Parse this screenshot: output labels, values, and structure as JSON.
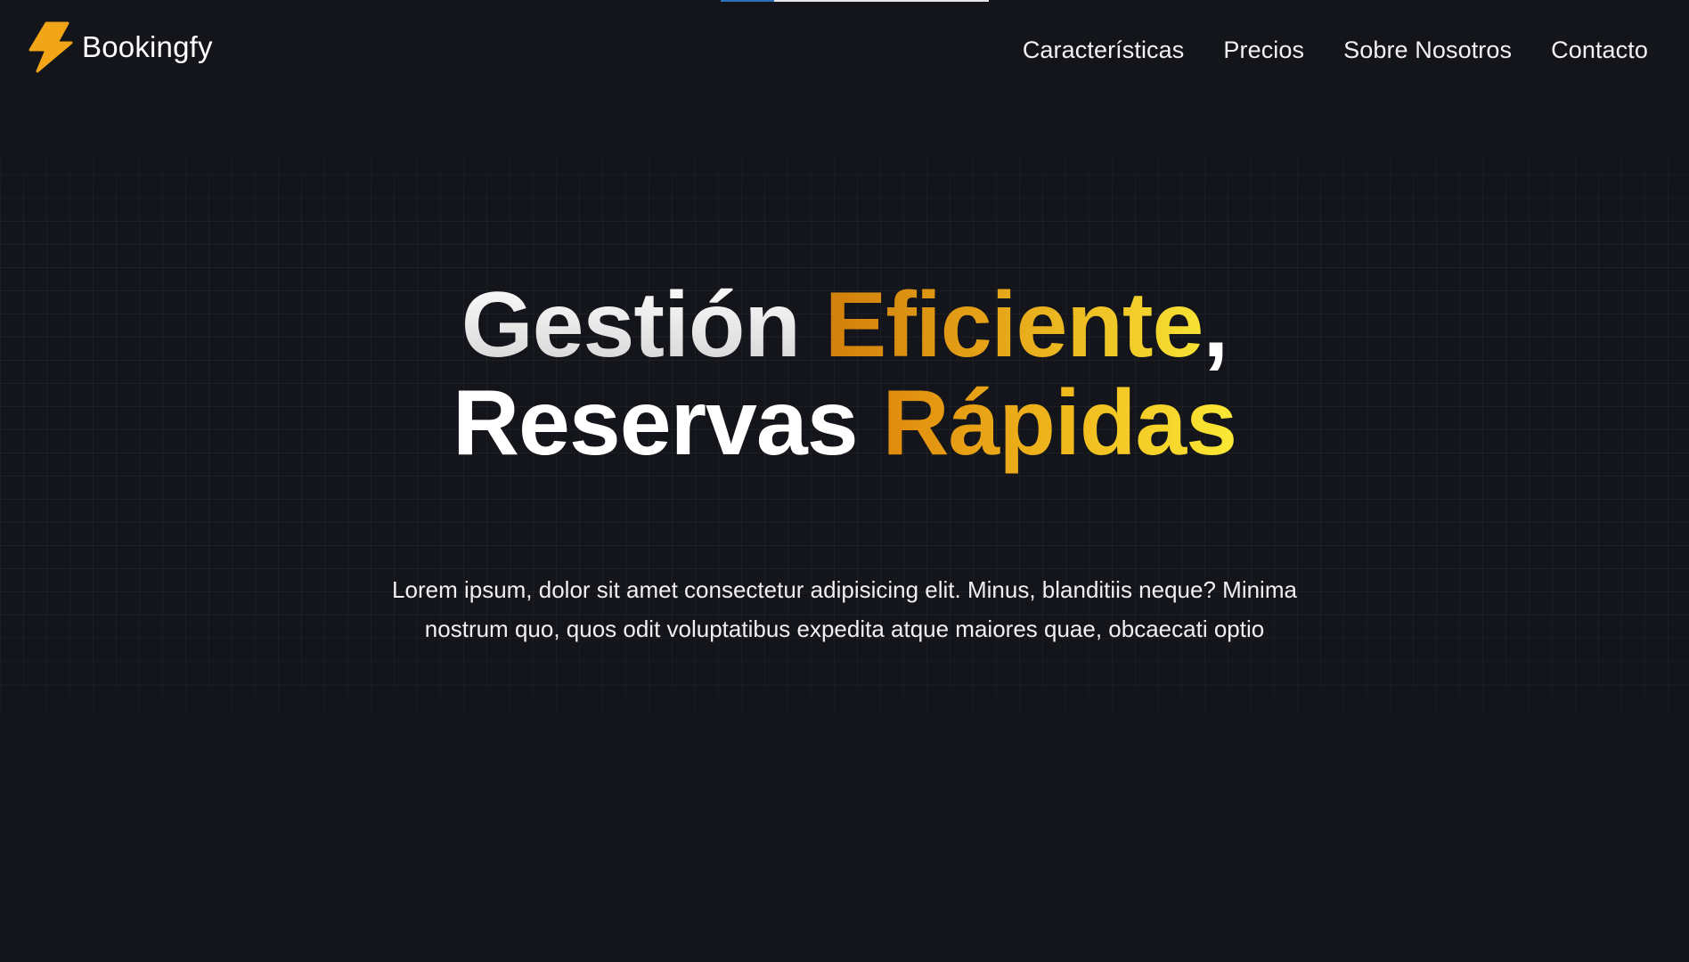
{
  "brand": {
    "name": "Bookingfy",
    "icon": "lightning-bolt-icon",
    "accent": "#f2a516"
  },
  "nav": {
    "items": [
      {
        "label": "Características"
      },
      {
        "label": "Precios"
      },
      {
        "label": "Sobre Nosotros"
      },
      {
        "label": "Contacto"
      }
    ]
  },
  "hero": {
    "title_line1_part1": "Gestión ",
    "title_line1_part2": "Eficiente",
    "title_line1_part3": ",",
    "title_line2_part1": "Reservas ",
    "title_line2_part2": "Rápidas",
    "description": "Lorem ipsum, dolor sit amet consectetur adipisicing elit. Minus, blanditiis neque? Minima nostrum quo, quos odit voluptatibus expedita atque maiores quae, obcaecati optio"
  },
  "colors": {
    "background": "#13151b",
    "gradient_start": "#d17f0b",
    "gradient_end": "#f8e234",
    "text": "#ffffff"
  }
}
